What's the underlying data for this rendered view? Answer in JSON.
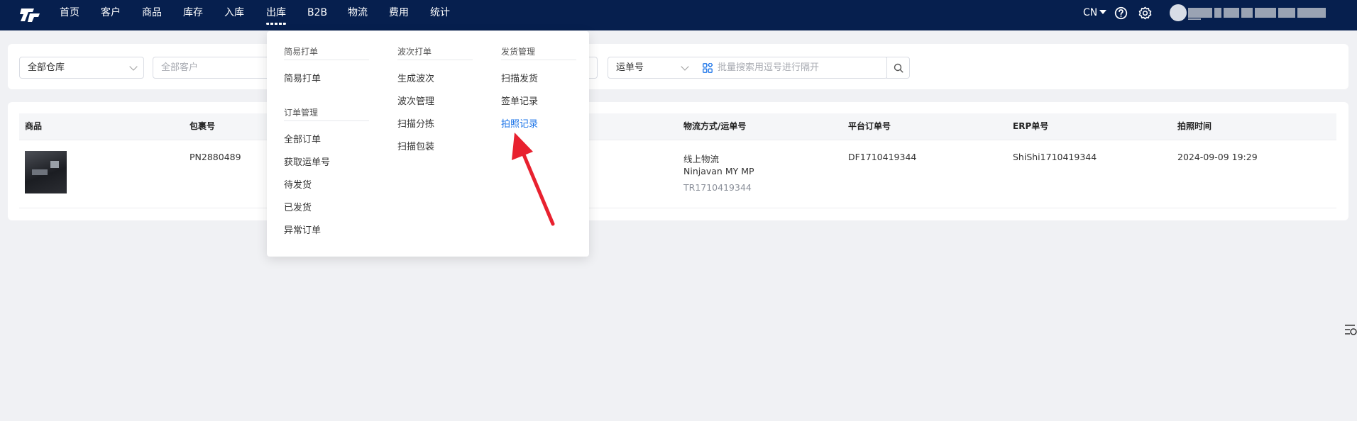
{
  "nav": {
    "items": [
      "首页",
      "客户",
      "商品",
      "库存",
      "入库",
      "出库",
      "B2B",
      "物流",
      "费用",
      "统计"
    ],
    "active": "出库",
    "lang": "CN",
    "username_masked": "████ ███ ████████████"
  },
  "filters": {
    "warehouse": "全部仓库",
    "customer_placeholder": "全部客户",
    "search_type": "运单号",
    "batch_placeholder": "批量搜索用逗号进行隔开"
  },
  "dropdown": {
    "groups": [
      {
        "title": "简易打单",
        "items": [
          "简易打单"
        ]
      },
      {
        "title": "订单管理",
        "items": [
          "全部订单",
          "获取运单号",
          "待发货",
          "已发货",
          "异常订单"
        ]
      },
      {
        "title": "波次打单",
        "items": [
          "生成波次",
          "波次管理",
          "扫描分拣",
          "扫描包装"
        ]
      },
      {
        "title": "发货管理",
        "items": [
          "扫描发货",
          "签单记录",
          "拍照记录"
        ]
      }
    ],
    "highlighted": "拍照记录"
  },
  "table": {
    "headers": [
      "商品",
      "包裹号",
      "物流方式/运单号",
      "平台订单号",
      "ERP单号",
      "拍照时间"
    ],
    "rows": [
      {
        "package_no": "PN2880489",
        "logistics": "线上物流",
        "carrier": "Ninjavan MY MP",
        "tracking": "TR1710419344",
        "platform_order": "DF1710419344",
        "erp_no": "ShiShi1710419344",
        "photo_time": "2024-09-09 19:29"
      }
    ]
  },
  "colors": {
    "nav_bg": "#061f4e",
    "accent": "#1a73e8",
    "annotation_arrow": "#e8212f"
  }
}
